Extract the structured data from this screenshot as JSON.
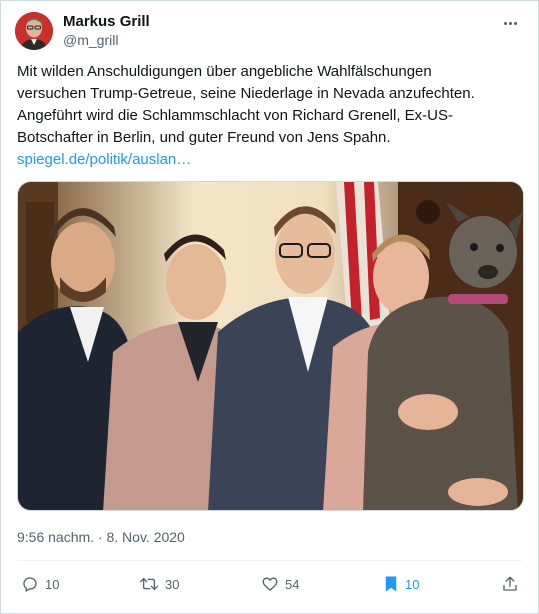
{
  "author": {
    "display_name": "Markus Grill",
    "handle": "@m_grill"
  },
  "tweet": {
    "lines": [
      "Mit wilden Anschuldigungen über angebliche Wahlfälschungen",
      "versuchen Trump-Getreue, seine Niederlage in Nevada anzufechten.",
      "Angeführt wird die Schlammschlacht von Richard Grenell, Ex-US-",
      "Botschafter in Berlin, und guter Freund von Jens Spahn."
    ],
    "link": "spiegel.de/politik/auslan…",
    "timestamp": "9:56 nachm. · 8. Nov. 2020"
  },
  "actions": {
    "replies": "10",
    "retweets": "30",
    "likes": "54",
    "bookmarks": "10"
  },
  "icons": {
    "more": "more-horizontal-icon",
    "reply": "reply-icon",
    "retweet": "retweet-icon",
    "like": "heart-icon",
    "bookmark": "bookmark-icon",
    "share": "share-icon"
  },
  "colors": {
    "link": "#1d9bf0",
    "secondary_text": "#536471",
    "bookmark_active": "#1d9bf0"
  }
}
